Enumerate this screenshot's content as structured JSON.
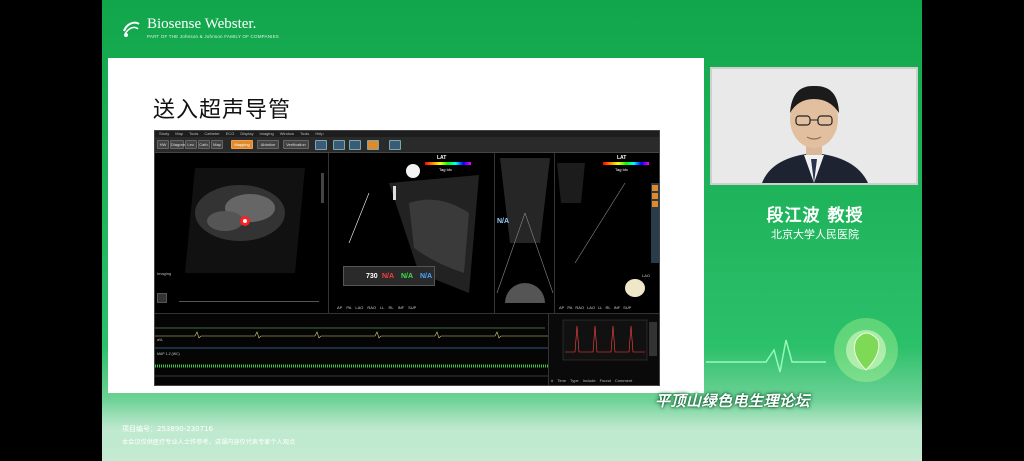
{
  "brand": {
    "logo_text": "Biosense Webster.",
    "logo_sub": "PART OF THE Johnson & Johnson FAMILY OF COMPANIES"
  },
  "slide": {
    "title": "送入超声导管"
  },
  "app": {
    "menu": [
      "Study",
      "Map",
      "Tools",
      "Catheter",
      "ECG",
      "Display",
      "Imaging",
      "Window",
      "Tools",
      "Help"
    ],
    "toolbar": {
      "btn_mapping": "Mapping",
      "btn_ablation": "Ablation",
      "btn_verification": "Verification",
      "tabs": [
        "HW",
        "Diagrams",
        "Lev.",
        "Cath.",
        "Map"
      ]
    },
    "left_pane": {
      "label": "Imaging"
    },
    "mid_pane": {
      "lat_label": "LAT",
      "tag_label": "Tag Idx",
      "rr_value": "730",
      "na_values": [
        "N/A",
        "N/A",
        "N/A"
      ],
      "na_center": "N/A",
      "views": [
        "AP",
        "PA",
        "LAO",
        "RAO",
        "LL",
        "RL",
        "INF",
        "SUP"
      ]
    },
    "right_pane": {
      "lat_label": "LAT",
      "tag_label": "Tag Idx",
      "view_label": "LAO",
      "views": [
        "AP",
        "PA",
        "RAO",
        "LAO",
        "LL",
        "RL",
        "INF",
        "SUP"
      ]
    },
    "ecg": {
      "lead_labels": [
        "aVL",
        "MAP 1-2 (WC)"
      ]
    },
    "map_table": {
      "columns": [
        "#",
        "Time",
        "Type",
        "Include",
        "Found",
        "Comment"
      ]
    }
  },
  "speaker": {
    "name": "段江波  教授",
    "hospital": "北京大学人民医院"
  },
  "footer": {
    "forum": "平顶山绿色电生理论坛",
    "project_id": "项目编号：253890-230716",
    "disclaimer": "本会议仅供医疗专业人士作参考，讲课内容仅代表专家个人观点"
  },
  "colors": {
    "background_green": "#1eb35a",
    "accent_orange": "#e08a2c",
    "na_red": "#ff3b3b",
    "na_green": "#3ee04a",
    "na_blue": "#4aa8ff"
  }
}
